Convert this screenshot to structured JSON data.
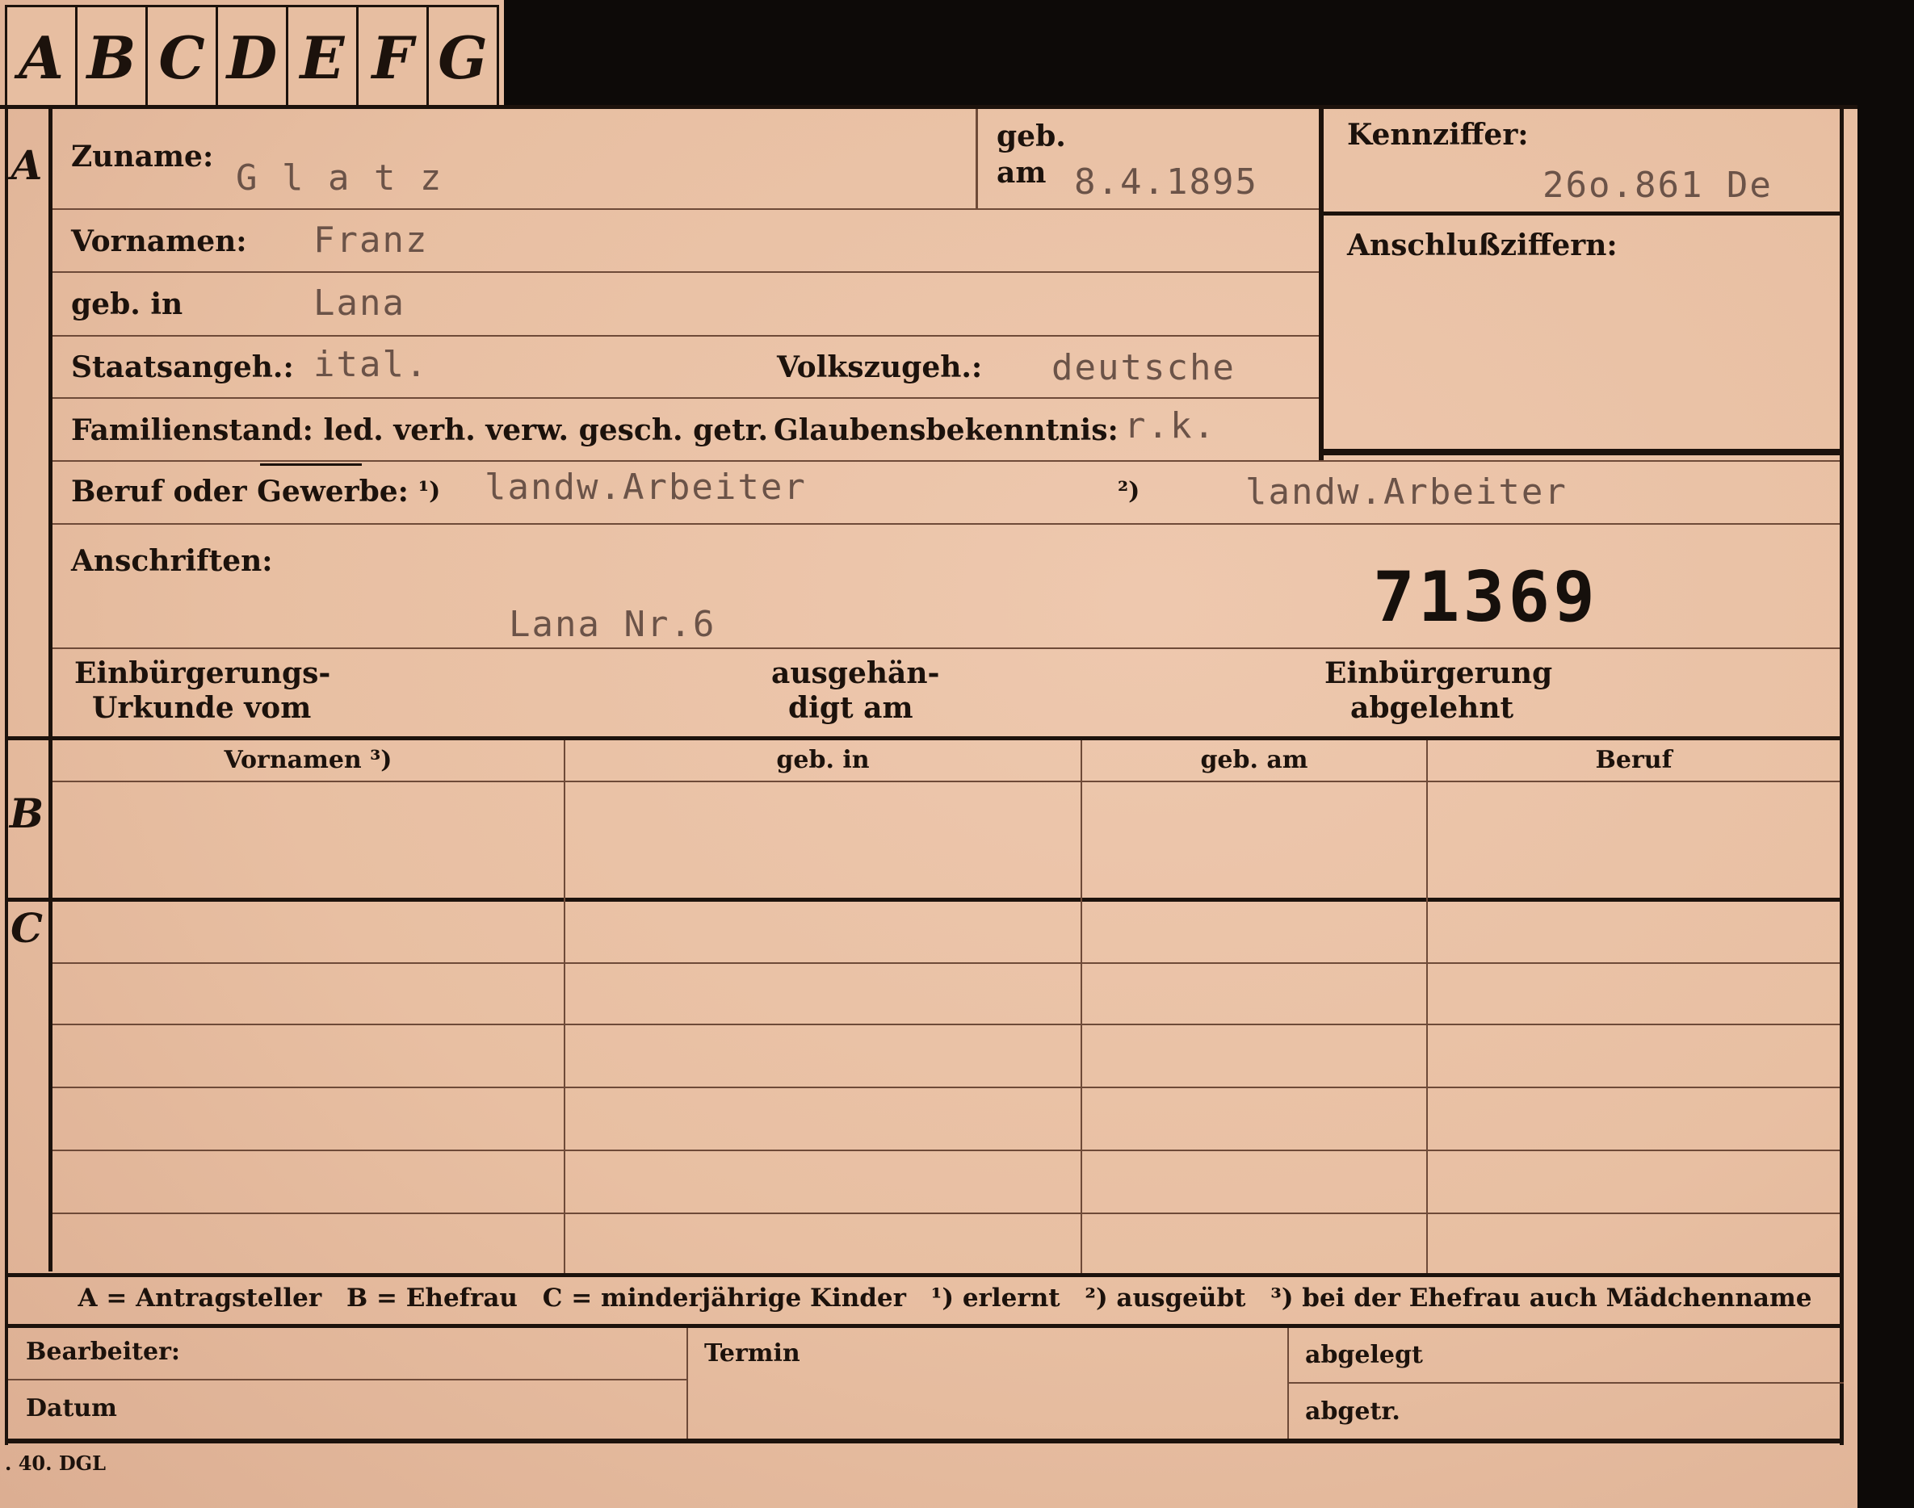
{
  "tabs": [
    "A",
    "B",
    "C",
    "D",
    "E",
    "F",
    "G"
  ],
  "sections": {
    "a": "A",
    "b": "B",
    "c": "C"
  },
  "labels": {
    "zuname": "Zuname:",
    "geb_am_1": "geb.",
    "geb_am_2": "am",
    "kennziffer": "Kennziffer:",
    "anschlussziffern": "Anschlußziffern:",
    "vornamen": "Vornamen:",
    "geb_in": "geb. in",
    "staatsangeh": "Staatsangeh.:",
    "volkszugeh": "Volkszugeh.:",
    "familienstand": "Familienstand: led. verh. verw. gesch. getr.",
    "glaubensbekenntnis": "Glaubensbekenntnis:",
    "beruf": "Beruf oder Gewerbe:",
    "beruf_note1": "¹)",
    "beruf_note2": "²)",
    "anschriften": "Anschriften:",
    "einbuergerungs_1": "Einbürgerungs-",
    "einbuergerungs_2": "Urkunde vom",
    "ausgehaen_1": "ausgehän-",
    "ausgehaen_2": "digt am",
    "einbuergerung_1": "Einbürgerung",
    "einbuergerung_2": "abgelehnt"
  },
  "values": {
    "zuname": "G l a t z",
    "geb_am": "8.4.1895",
    "kennziffer": "26o.861  De",
    "vornamen": "Franz",
    "geb_in": "Lana",
    "staatsangeh": "ital.",
    "volkszugeh": "deutsche",
    "glaubensbekenntnis": "r.k.",
    "beruf1": "landw.Arbeiter",
    "beruf2": "landw.Arbeiter",
    "anschrift": "Lana Nr.6",
    "stamp_number": "71369"
  },
  "table": {
    "headers": [
      "Vornamen ³)",
      "geb. in",
      "geb. am",
      "Beruf"
    ]
  },
  "legend": [
    "A = Antragsteller",
    "B = Ehefrau",
    "C = minderjährige Kinder",
    "¹) erlernt",
    "²) ausgeübt",
    "³) bei der Ehefrau auch Mädchenname"
  ],
  "footer": {
    "bearbeiter": "Bearbeiter:",
    "datum": "Datum",
    "termin": "Termin",
    "abgelegt": "abgelegt",
    "abgetr": "abgetr.",
    "print_code": ". 40. DGL"
  }
}
